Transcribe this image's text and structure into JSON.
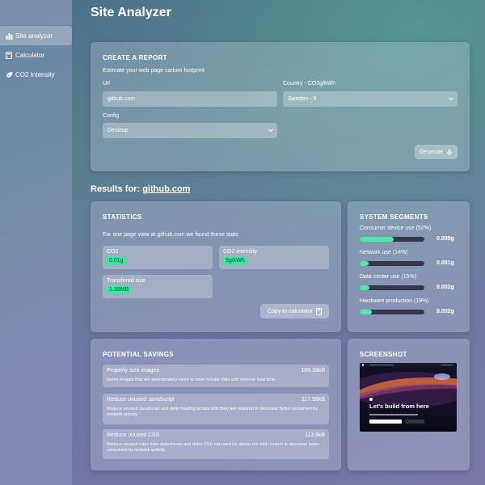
{
  "app_title": "Site Analyzer",
  "sidebar": {
    "items": [
      {
        "label": "Site analyzer",
        "icon": "bar-chart-icon"
      },
      {
        "label": "Calculator",
        "icon": "calculator-icon"
      },
      {
        "label": "CO2 Intensity",
        "icon": "leaf-icon"
      }
    ]
  },
  "report": {
    "title": "CREATE A REPORT",
    "subtitle": "Estimate your web page carbon footprint",
    "url_label": "Url",
    "url_value": "github.com",
    "country_label": "Country - CO2g/kWh",
    "country_value": "Sweden - 9",
    "config_label": "Config",
    "config_value": "Desktop",
    "generate_label": "Generate"
  },
  "results": {
    "prefix": "Results for:",
    "site": "github.com"
  },
  "statistics": {
    "title": "STATISTICS",
    "intro": "For one page view at github.com we found these stats",
    "co2_label": "CO2",
    "co2_value": "0.01g",
    "intensity_label": "CO2 intensity",
    "intensity_value": "9g/kWh",
    "transfer_label": "Transfered size",
    "transfer_value": "1.39MB",
    "copy_label": "Copy to calculator"
  },
  "segments": {
    "title": "SYSTEM SEGMENTS",
    "items": [
      {
        "label": "Consumer device use (52%)",
        "value": "0.005g",
        "fraction": 0.52
      },
      {
        "label": "Network use (14%)",
        "value": "0.001g",
        "fraction": 0.14
      },
      {
        "label": "Data center use (15%)",
        "value": "0.002g",
        "fraction": 0.15
      },
      {
        "label": "Hardware production (19%)",
        "value": "0.002g",
        "fraction": 0.19
      }
    ]
  },
  "savings": {
    "title": "POTENTIAL SAVINGS",
    "items": [
      {
        "name": "Properly size images",
        "size": "189.38kB",
        "desc": "Serve images that are appropriately-sized to save cellular data and improve load time."
      },
      {
        "name": "Reduce unused JavaScript",
        "size": "117.98kB",
        "desc": "Reduce unused JavaScript and defer loading scripts until they are required to decrease bytes consumed by network activity."
      },
      {
        "name": "Reduce unused CSS",
        "size": "113.9kB",
        "desc": "Reduce unused rules from stylesheets and defer CSS not used for above-the-fold content to decrease bytes consumed by network activity."
      }
    ]
  },
  "screenshot": {
    "title": "SCREENSHOT",
    "headline": "Let's build from here"
  },
  "colors": {
    "accent": "#3de6a0",
    "bar_track": "#34384a"
  }
}
